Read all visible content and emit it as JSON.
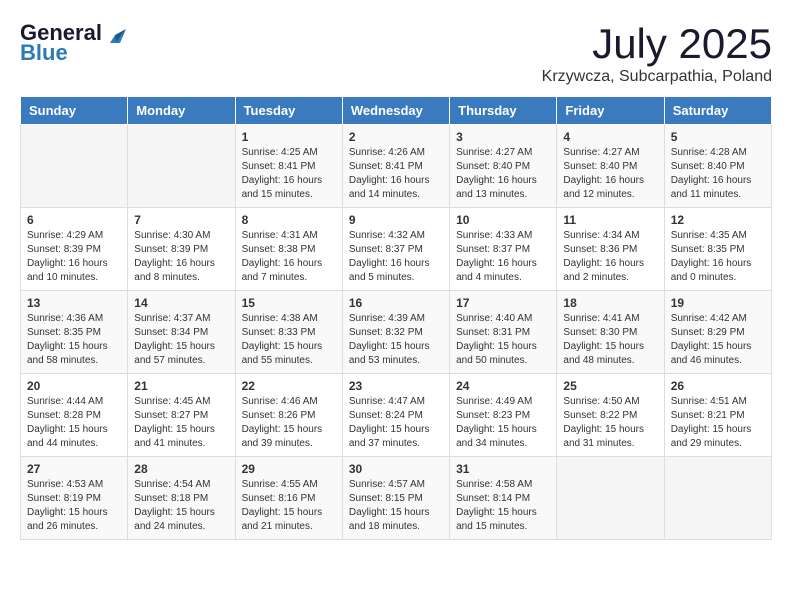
{
  "logo": {
    "general": "General",
    "blue": "Blue"
  },
  "title": "July 2025",
  "location": "Krzywcza, Subcarpathia, Poland",
  "days_of_week": [
    "Sunday",
    "Monday",
    "Tuesday",
    "Wednesday",
    "Thursday",
    "Friday",
    "Saturday"
  ],
  "weeks": [
    [
      {
        "day": "",
        "content": ""
      },
      {
        "day": "",
        "content": ""
      },
      {
        "day": "1",
        "content": "Sunrise: 4:25 AM\nSunset: 8:41 PM\nDaylight: 16 hours\nand 15 minutes."
      },
      {
        "day": "2",
        "content": "Sunrise: 4:26 AM\nSunset: 8:41 PM\nDaylight: 16 hours\nand 14 minutes."
      },
      {
        "day": "3",
        "content": "Sunrise: 4:27 AM\nSunset: 8:40 PM\nDaylight: 16 hours\nand 13 minutes."
      },
      {
        "day": "4",
        "content": "Sunrise: 4:27 AM\nSunset: 8:40 PM\nDaylight: 16 hours\nand 12 minutes."
      },
      {
        "day": "5",
        "content": "Sunrise: 4:28 AM\nSunset: 8:40 PM\nDaylight: 16 hours\nand 11 minutes."
      }
    ],
    [
      {
        "day": "6",
        "content": "Sunrise: 4:29 AM\nSunset: 8:39 PM\nDaylight: 16 hours\nand 10 minutes."
      },
      {
        "day": "7",
        "content": "Sunrise: 4:30 AM\nSunset: 8:39 PM\nDaylight: 16 hours\nand 8 minutes."
      },
      {
        "day": "8",
        "content": "Sunrise: 4:31 AM\nSunset: 8:38 PM\nDaylight: 16 hours\nand 7 minutes."
      },
      {
        "day": "9",
        "content": "Sunrise: 4:32 AM\nSunset: 8:37 PM\nDaylight: 16 hours\nand 5 minutes."
      },
      {
        "day": "10",
        "content": "Sunrise: 4:33 AM\nSunset: 8:37 PM\nDaylight: 16 hours\nand 4 minutes."
      },
      {
        "day": "11",
        "content": "Sunrise: 4:34 AM\nSunset: 8:36 PM\nDaylight: 16 hours\nand 2 minutes."
      },
      {
        "day": "12",
        "content": "Sunrise: 4:35 AM\nSunset: 8:35 PM\nDaylight: 16 hours\nand 0 minutes."
      }
    ],
    [
      {
        "day": "13",
        "content": "Sunrise: 4:36 AM\nSunset: 8:35 PM\nDaylight: 15 hours\nand 58 minutes."
      },
      {
        "day": "14",
        "content": "Sunrise: 4:37 AM\nSunset: 8:34 PM\nDaylight: 15 hours\nand 57 minutes."
      },
      {
        "day": "15",
        "content": "Sunrise: 4:38 AM\nSunset: 8:33 PM\nDaylight: 15 hours\nand 55 minutes."
      },
      {
        "day": "16",
        "content": "Sunrise: 4:39 AM\nSunset: 8:32 PM\nDaylight: 15 hours\nand 53 minutes."
      },
      {
        "day": "17",
        "content": "Sunrise: 4:40 AM\nSunset: 8:31 PM\nDaylight: 15 hours\nand 50 minutes."
      },
      {
        "day": "18",
        "content": "Sunrise: 4:41 AM\nSunset: 8:30 PM\nDaylight: 15 hours\nand 48 minutes."
      },
      {
        "day": "19",
        "content": "Sunrise: 4:42 AM\nSunset: 8:29 PM\nDaylight: 15 hours\nand 46 minutes."
      }
    ],
    [
      {
        "day": "20",
        "content": "Sunrise: 4:44 AM\nSunset: 8:28 PM\nDaylight: 15 hours\nand 44 minutes."
      },
      {
        "day": "21",
        "content": "Sunrise: 4:45 AM\nSunset: 8:27 PM\nDaylight: 15 hours\nand 41 minutes."
      },
      {
        "day": "22",
        "content": "Sunrise: 4:46 AM\nSunset: 8:26 PM\nDaylight: 15 hours\nand 39 minutes."
      },
      {
        "day": "23",
        "content": "Sunrise: 4:47 AM\nSunset: 8:24 PM\nDaylight: 15 hours\nand 37 minutes."
      },
      {
        "day": "24",
        "content": "Sunrise: 4:49 AM\nSunset: 8:23 PM\nDaylight: 15 hours\nand 34 minutes."
      },
      {
        "day": "25",
        "content": "Sunrise: 4:50 AM\nSunset: 8:22 PM\nDaylight: 15 hours\nand 31 minutes."
      },
      {
        "day": "26",
        "content": "Sunrise: 4:51 AM\nSunset: 8:21 PM\nDaylight: 15 hours\nand 29 minutes."
      }
    ],
    [
      {
        "day": "27",
        "content": "Sunrise: 4:53 AM\nSunset: 8:19 PM\nDaylight: 15 hours\nand 26 minutes."
      },
      {
        "day": "28",
        "content": "Sunrise: 4:54 AM\nSunset: 8:18 PM\nDaylight: 15 hours\nand 24 minutes."
      },
      {
        "day": "29",
        "content": "Sunrise: 4:55 AM\nSunset: 8:16 PM\nDaylight: 15 hours\nand 21 minutes."
      },
      {
        "day": "30",
        "content": "Sunrise: 4:57 AM\nSunset: 8:15 PM\nDaylight: 15 hours\nand 18 minutes."
      },
      {
        "day": "31",
        "content": "Sunrise: 4:58 AM\nSunset: 8:14 PM\nDaylight: 15 hours\nand 15 minutes."
      },
      {
        "day": "",
        "content": ""
      },
      {
        "day": "",
        "content": ""
      }
    ]
  ]
}
